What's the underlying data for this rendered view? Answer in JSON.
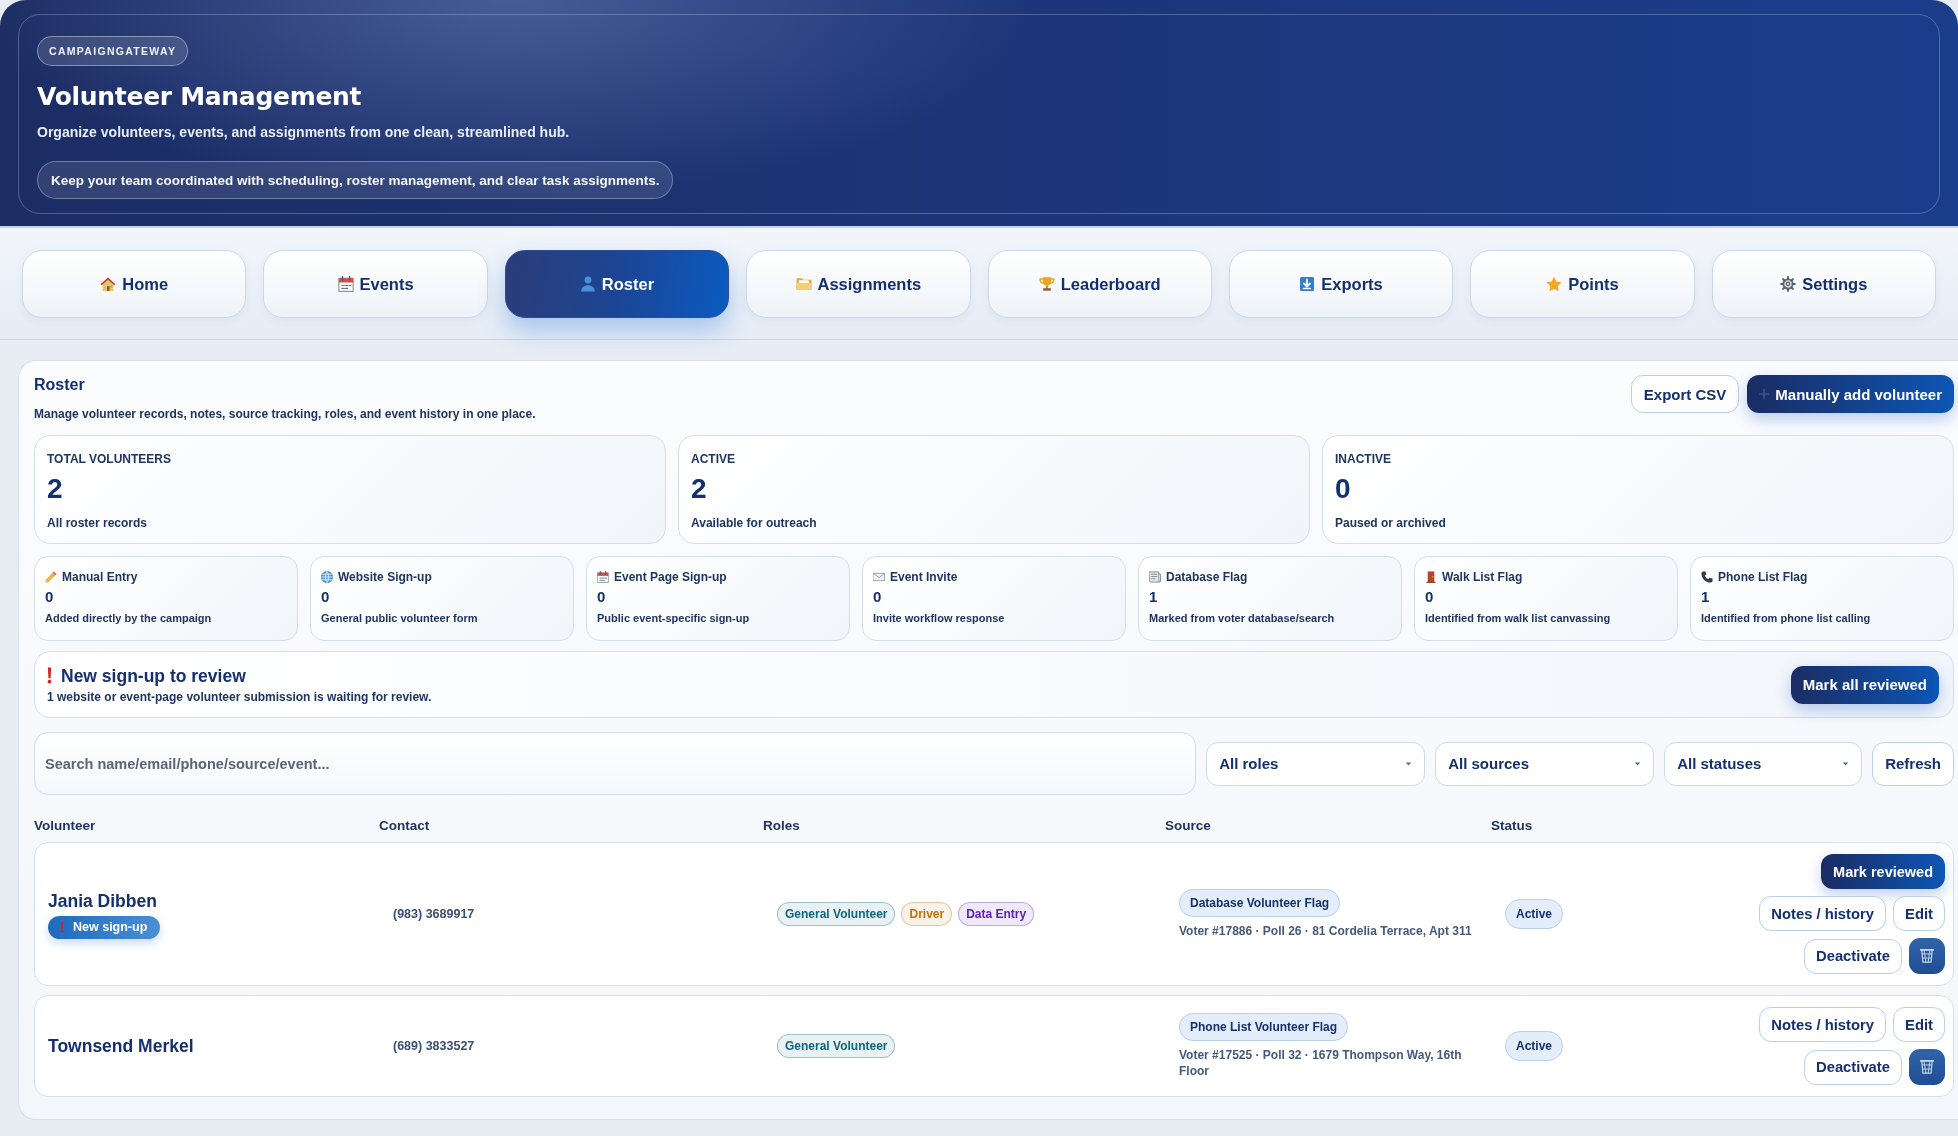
{
  "header": {
    "brand": "CAMPAIGNGATEWAY",
    "title": "Volunteer Management",
    "subtitle": "Organize volunteers, events, and assignments from one clean, streamlined hub.",
    "note": "Keep your team coordinated with scheduling, roster management, and clear task assignments."
  },
  "tabs": [
    {
      "label": "Home",
      "selected": false
    },
    {
      "label": "Events",
      "selected": false
    },
    {
      "label": "Roster",
      "selected": true
    },
    {
      "label": "Assignments",
      "selected": false
    },
    {
      "label": "Leaderboard",
      "selected": false
    },
    {
      "label": "Exports",
      "selected": false
    },
    {
      "label": "Points",
      "selected": false
    },
    {
      "label": "Settings",
      "selected": false
    }
  ],
  "roster": {
    "title": "Roster",
    "description": "Manage volunteer records, notes, source tracking, roles, and event history in one place.",
    "export_button": "Export CSV",
    "add_button": "Manually add volunteer"
  },
  "stats": [
    {
      "label": "TOTAL VOLUNTEERS",
      "value": "2",
      "caption": "All roster records"
    },
    {
      "label": "ACTIVE",
      "value": "2",
      "caption": "Available for outreach"
    },
    {
      "label": "INACTIVE",
      "value": "0",
      "caption": "Paused or archived"
    }
  ],
  "sources": [
    {
      "label": "Manual Entry",
      "count": "0",
      "caption": "Added directly by the campaign"
    },
    {
      "label": "Website Sign-up",
      "count": "0",
      "caption": "General public volunteer form"
    },
    {
      "label": "Event Page Sign-up",
      "count": "0",
      "caption": "Public event-specific sign-up"
    },
    {
      "label": "Event Invite",
      "count": "0",
      "caption": "Invite workflow response"
    },
    {
      "label": "Database Flag",
      "count": "1",
      "caption": "Marked from voter database/search"
    },
    {
      "label": "Walk List Flag",
      "count": "0",
      "caption": "Identified from walk list canvassing"
    },
    {
      "label": "Phone List Flag",
      "count": "1",
      "caption": "Identified from phone list calling"
    }
  ],
  "review_notice": {
    "title": "New sign-up to review",
    "message": "1 website or event-page volunteer submission is waiting for review.",
    "button": "Mark all reviewed"
  },
  "filters": {
    "search": {
      "placeholder": "Search name/email/phone/source/event..."
    },
    "selects": [
      {
        "value": "All roles"
      },
      {
        "value": "All sources"
      },
      {
        "value": "All statuses"
      }
    ],
    "refresh_button": "Refresh"
  },
  "table": {
    "columns": [
      "Volunteer",
      "Contact",
      "Roles",
      "Source",
      "Status"
    ],
    "rows": [
      {
        "name": "Jania Dibben",
        "badge": "New sign-up",
        "contact": "(983) 3689917",
        "roles": [
          {
            "label": "General Volunteer",
            "color": "#0f6680"
          },
          {
            "label": "Driver",
            "color": "#c2700a"
          },
          {
            "label": "Data Entry",
            "color": "#5b21b6"
          }
        ],
        "source": {
          "tag": "Database Volunteer Flag",
          "detail": "Voter #17886 · Poll 26 · 81 Cordelia Terrace, Apt 311"
        },
        "status": "Active",
        "review_button": "Mark reviewed",
        "actions": [
          {
            "label": "Notes / history"
          },
          {
            "label": "Edit"
          },
          {
            "label": "Deactivate"
          }
        ]
      },
      {
        "name": "Townsend Merkel",
        "contact": "(689) 3833527",
        "roles": [
          {
            "label": "General Volunteer",
            "color": "#0f6680"
          }
        ],
        "source": {
          "tag": "Phone List Volunteer Flag",
          "detail": "Voter #17525 · Poll 32 · 1679 Thompson Way, 16th Floor"
        },
        "status": "Active",
        "actions": [
          {
            "label": "Notes / history"
          },
          {
            "label": "Edit"
          },
          {
            "label": "Deactivate"
          }
        ]
      }
    ]
  }
}
